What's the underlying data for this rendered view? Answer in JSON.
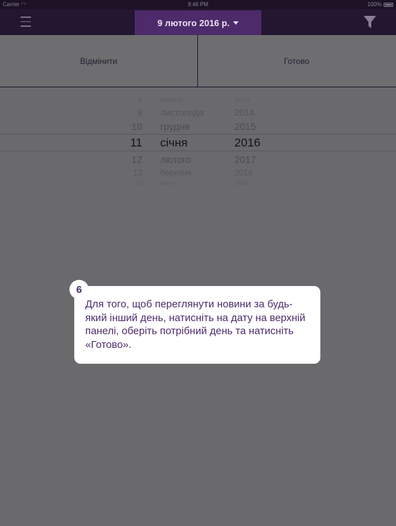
{
  "status_bar": {
    "carrier": "Carrier",
    "wifi_icon": "wifi-icon",
    "time": "9:46 PM",
    "battery_percent": "100%"
  },
  "nav": {
    "menu_icon": "hamburger-menu-icon",
    "date_label": "9 лютого 2016 р.",
    "filter_icon": "filter-icon",
    "colors": {
      "bar": "#241530",
      "accent": "#4d2a6a"
    }
  },
  "actions": {
    "cancel_label": "Відмінити",
    "done_label": "Готово"
  },
  "picker": {
    "days": [
      "8",
      "9",
      "10",
      "11",
      "12",
      "13",
      "14"
    ],
    "months": [
      "жовтня",
      "листопада",
      "грудня",
      "січня",
      "лютого",
      "березня",
      "квітня"
    ],
    "years": [
      "2013",
      "2014",
      "2015",
      "2016",
      "2017",
      "2018",
      "2019"
    ],
    "selected": {
      "day": "11",
      "month": "січня",
      "year": "2016"
    }
  },
  "tooltip": {
    "step": "6",
    "text": "Для того, щоб переглянути новини за будь-який інший день, натисніть на дату на верхній панелі, оберіть потрібний день та натисніть «Готово»."
  }
}
